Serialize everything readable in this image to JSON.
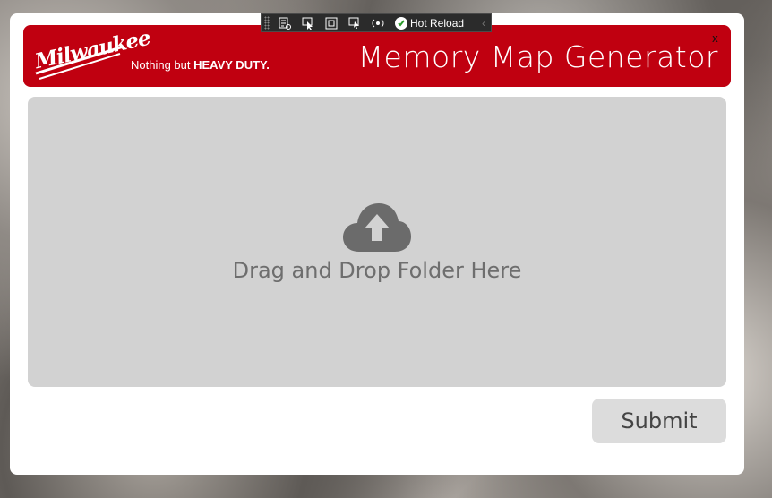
{
  "debug_toolbar": {
    "icons": [
      "live-visual-tree-icon",
      "select-element-icon",
      "display-layout-adorners-icon",
      "track-focused-element-icon",
      "binding-failures-icon"
    ],
    "hot_reload_label": "Hot Reload"
  },
  "header": {
    "brand": "Milwaukee",
    "tagline_prefix": "Nothing but ",
    "tagline_bold": "HEAVY DUTY.",
    "title": "Memory Map Generator",
    "close_label": "x",
    "color": "#c00010"
  },
  "drop_zone": {
    "icon": "cloud-upload-icon",
    "text": "Drag and Drop Folder Here"
  },
  "actions": {
    "submit_label": "Submit"
  }
}
